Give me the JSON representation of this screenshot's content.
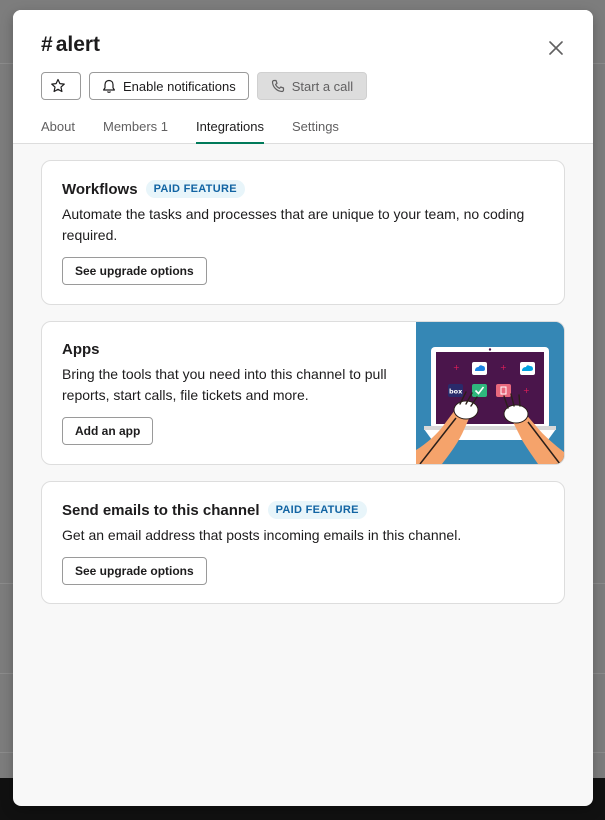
{
  "channel": {
    "hash": "#",
    "name": "alert"
  },
  "actions": {
    "notifications_label": "Enable notifications",
    "call_label": "Start a call"
  },
  "tabs": [
    {
      "label": "About"
    },
    {
      "label": "Members 1"
    },
    {
      "label": "Integrations",
      "active": true
    },
    {
      "label": "Settings"
    }
  ],
  "cards": {
    "workflows": {
      "title": "Workflows",
      "badge": "PAID FEATURE",
      "description": "Automate the tasks and processes that are unique to your team, no coding required.",
      "button": "See upgrade options"
    },
    "apps": {
      "title": "Apps",
      "description": "Bring the tools that you need into this channel to pull reports, start calls, file tickets and more.",
      "button": "Add an app",
      "illustration_label": "box"
    },
    "emails": {
      "title": "Send emails to this channel",
      "badge": "PAID FEATURE",
      "description": "Get an email address that posts incoming emails in this channel.",
      "button": "See upgrade options"
    }
  },
  "colors": {
    "accent_tab": "#007a5a",
    "badge_text": "#1264a3",
    "badge_bg": "#e8f5fa",
    "illustration_bg": "#3587b5"
  }
}
